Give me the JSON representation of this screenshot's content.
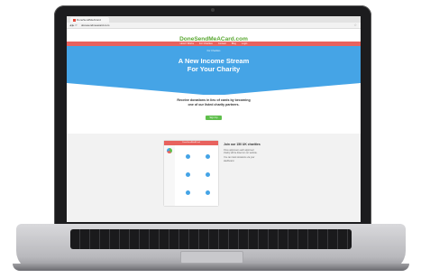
{
  "browser": {
    "tab_title": "DoneSendMeACard",
    "url": "donesendmeacard.com",
    "nav_glyph": "◀ ▶ ⟳",
    "star_glyph": "☆"
  },
  "site": {
    "logo": "DoneSendMeACard.com",
    "menu": [
      "How It Works",
      "For Charities",
      "Contact",
      "Blog",
      "Login"
    ],
    "hero_small": "For Charities",
    "hero_title_line1": "A New Income Stream",
    "hero_title_line2": "For Your Charity",
    "tagline_line1": "Receive donations in lieu of cards by becoming",
    "tagline_line2": "one of our listed charity partners.",
    "signup_label": "Sign Up",
    "dashboard_header": "DoneSendMeACard",
    "join_title": "Join our 150 UK charities",
    "join_text_1": "Once approved, each approved",
    "join_text_2": "charity will be listed on our website.",
    "join_text_3": "You can track donations via your",
    "join_text_4": "dashboard."
  },
  "colors": {
    "brand_green": "#5aa832",
    "menu_red": "#e8625e",
    "hero_blue": "#45a4e6",
    "button_green": "#5fbf4c"
  }
}
